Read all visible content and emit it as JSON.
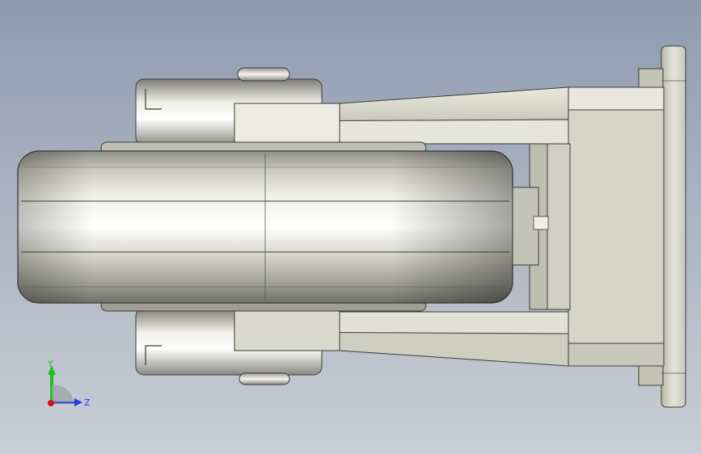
{
  "view": {
    "background_top": "#8e9bb0",
    "background_bottom": "#c9ced6",
    "model_color": "#d8d8c8"
  },
  "triad": {
    "y_label": "Y",
    "z_label": "Z",
    "y_color": "#1fbf1f",
    "z_color": "#1f3fdf",
    "x_color": "#e01010"
  }
}
